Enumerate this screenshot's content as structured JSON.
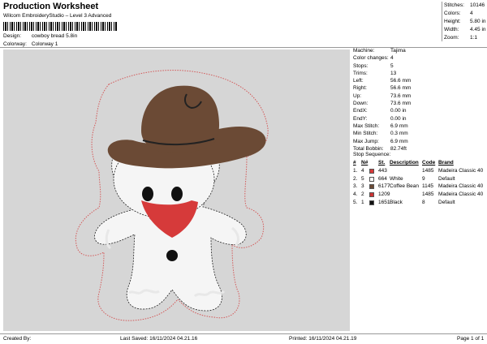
{
  "header": {
    "title": "Production Worksheet",
    "subtitle": "Wilcom EmbroideryStudio – Level 3 Advanced",
    "design_label": "Design:",
    "design_value": "cowboy bread 5.8in",
    "colorway_label": "Colorway:",
    "colorway_value": "Colorway 1"
  },
  "stats": [
    {
      "label": "Stitches:",
      "value": "10146"
    },
    {
      "label": "Colors:",
      "value": "4"
    },
    {
      "label": "Height:",
      "value": "5.80 in"
    },
    {
      "label": "Width:",
      "value": "4.45 in"
    },
    {
      "label": "Zoom:",
      "value": "1:1"
    }
  ],
  "specs": [
    {
      "label": "Machine:",
      "value": "Tajima"
    },
    {
      "label": "Color changes:",
      "value": "4"
    },
    {
      "label": "Stops:",
      "value": "5"
    },
    {
      "label": "Trims:",
      "value": "13"
    },
    {
      "label": "Left:",
      "value": "56.6 mm"
    },
    {
      "label": "Right:",
      "value": "56.6 mm"
    },
    {
      "label": "Up:",
      "value": "73.6 mm"
    },
    {
      "label": "Down:",
      "value": "73.6 mm"
    },
    {
      "label": "EndX:",
      "value": "0.00 in"
    },
    {
      "label": "EndY:",
      "value": "0.00 in"
    },
    {
      "label": "Max Stitch:",
      "value": "6.9 mm"
    },
    {
      "label": "Min Stitch:",
      "value": "0.3 mm"
    },
    {
      "label": "Max Jump:",
      "value": "6.9 mm"
    },
    {
      "label": "Total Bobbin:",
      "value": "82.74ft"
    }
  ],
  "stop_sequence": {
    "title": "Stop Sequence:",
    "columns": {
      "num": "#",
      "n": "N#",
      "st": "St.",
      "desc": "Description",
      "code": "Code",
      "brand": "Brand"
    },
    "rows": [
      {
        "num": "1.",
        "n": "4",
        "color": "#d63a3a",
        "st": "443",
        "desc": "",
        "code": "1485",
        "brand": "Madeira Classic 40"
      },
      {
        "num": "2.",
        "n": "5",
        "color": "#ffffff",
        "st": "664",
        "desc": "White",
        "code": "9",
        "brand": "Default"
      },
      {
        "num": "3.",
        "n": "3",
        "color": "#6b4a35",
        "st": "6177",
        "desc": "Coffee Bean",
        "code": "1145",
        "brand": "Madeira Classic 40"
      },
      {
        "num": "4.",
        "n": "2",
        "color": "#cc3333",
        "st": "1209",
        "desc": "",
        "code": "1485",
        "brand": "Madeira Classic 40"
      },
      {
        "num": "5.",
        "n": "1",
        "color": "#111111",
        "st": "1651",
        "desc": "Black",
        "code": "8",
        "brand": "Default"
      }
    ]
  },
  "footer": {
    "created_by": "Created By:",
    "last_saved": "Last Saved: 16/11/2024 04.21.16",
    "printed": "Printed: 16/11/2024 04.21.19",
    "page": "Page 1 of 1"
  },
  "colors": {
    "canvas_bg": "#d6d6d6",
    "hat": "#6b4a35",
    "bandana": "#d63a3a",
    "body_fill": "#f5f5f5",
    "outline_red": "#d35a5a",
    "features": "#111111"
  }
}
